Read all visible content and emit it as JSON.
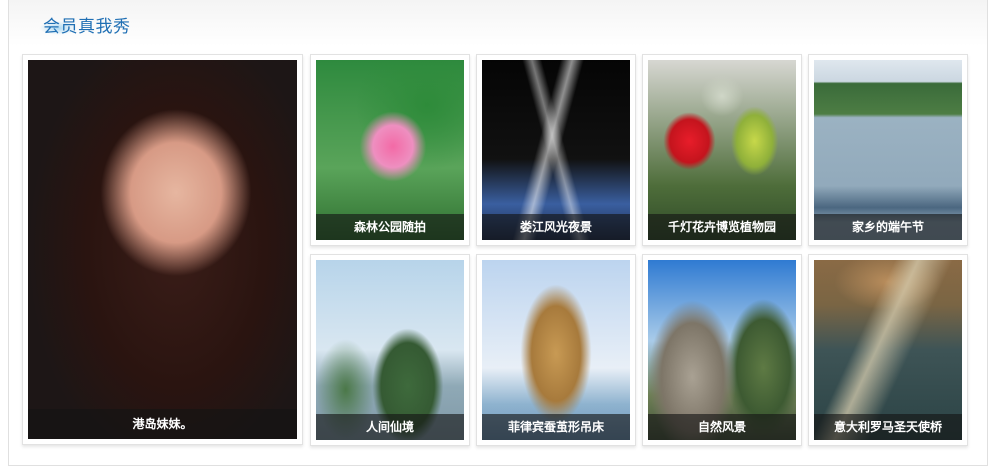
{
  "header": {
    "title": "会员真我秀"
  },
  "cards": [
    {
      "caption": "港岛妹妹。"
    },
    {
      "caption": "森林公园随拍"
    },
    {
      "caption": "娄江风光夜景"
    },
    {
      "caption": "千灯花卉博览植物园"
    },
    {
      "caption": "家乡的端午节"
    },
    {
      "caption": "人间仙境"
    },
    {
      "caption": "菲律宾蚕茧形吊床"
    },
    {
      "caption": "自然风景"
    },
    {
      "caption": "意大利罗马圣天使桥"
    }
  ],
  "colors": {
    "title": "#1f6fb4",
    "caption_bg": "rgba(20,20,20,0.62)",
    "card_border": "#e2e2e2"
  }
}
